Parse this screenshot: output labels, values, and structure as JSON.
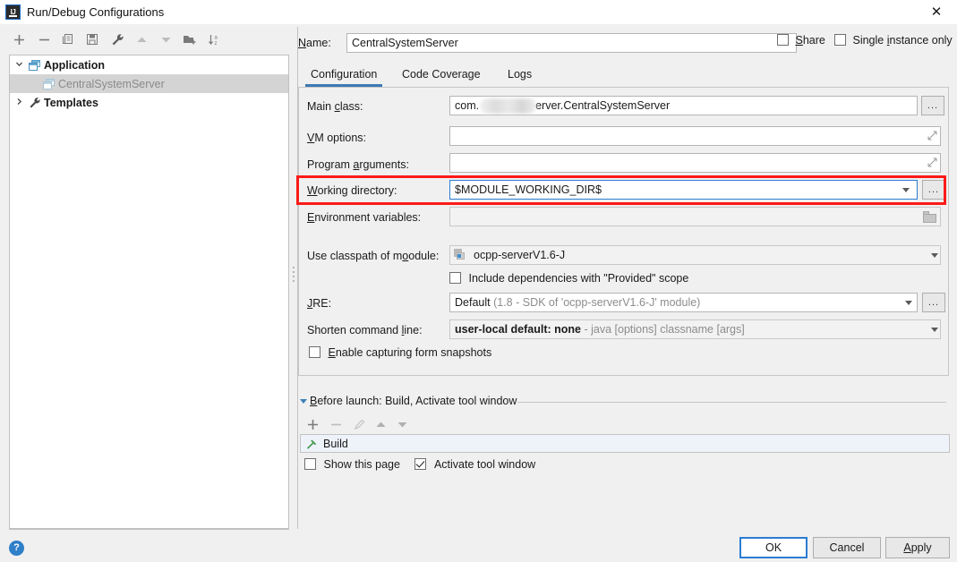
{
  "window": {
    "title": "Run/Debug Configurations",
    "app_icon": "intellij-idea-icon",
    "close_label": "✕"
  },
  "toolbar": {
    "items": [
      {
        "name": "add-configuration",
        "icon": "plus-icon",
        "glyph": "+"
      },
      {
        "name": "remove-configuration",
        "icon": "minus-icon",
        "glyph": "−"
      },
      {
        "name": "copy-configuration",
        "icon": "copy-icon",
        "glyph": "⧉"
      },
      {
        "name": "save-configuration",
        "icon": "save-icon",
        "glyph": "💾"
      },
      {
        "name": "edit-templates",
        "icon": "wrench-icon",
        "glyph": "🔧"
      },
      {
        "name": "move-up",
        "icon": "arrow-up-icon",
        "glyph": "▲"
      },
      {
        "name": "move-down",
        "icon": "arrow-down-icon",
        "glyph": "▼"
      },
      {
        "name": "move-into-folder",
        "icon": "folder-add-icon",
        "glyph": "📁"
      },
      {
        "name": "sort-configurations",
        "icon": "sort-alpha-icon",
        "glyph": "↓"
      }
    ]
  },
  "tree": {
    "nodes": [
      {
        "label": "Application",
        "icon": "application-icon",
        "expanded": true,
        "twisty": "⌄",
        "level": 0,
        "bold": true,
        "selected": false,
        "muted": false
      },
      {
        "label": "CentralSystemServer",
        "icon": "application-icon",
        "expanded": false,
        "twisty": "",
        "level": 1,
        "bold": false,
        "selected": true,
        "muted": true
      },
      {
        "label": "Templates",
        "icon": "wrench-icon",
        "expanded": false,
        "twisty": "›",
        "level": 0,
        "bold": true,
        "selected": false,
        "muted": false
      }
    ]
  },
  "name_row": {
    "label": "Name:",
    "value": "CentralSystemServer",
    "placeholder": "",
    "share_label": "Share",
    "share_checked": false,
    "single_instance_label": "Single instance only",
    "single_instance_checked": false
  },
  "tabs": [
    {
      "label": "Configuration",
      "active": true
    },
    {
      "label": "Code Coverage",
      "active": false
    },
    {
      "label": "Logs",
      "active": false
    }
  ],
  "config": {
    "main_class": {
      "label": "Main class:",
      "value_prefix": "com.",
      "value_suffix": "erver.CentralSystemServer",
      "redacted": true,
      "browse_button": "...",
      "browse_icon": "ellipsis-icon"
    },
    "vm_options": {
      "label": "VM options:",
      "value": "",
      "expand_icon": "expand-diagonal-icon"
    },
    "program_arguments": {
      "label": "Program arguments:",
      "value": "",
      "expand_icon": "expand-diagonal-icon"
    },
    "working_directory": {
      "label": "Working directory:",
      "value": "$MODULE_WORKING_DIR$",
      "dropdown_icon": "chevron-down-icon",
      "browse_button": "...",
      "highlighted": true,
      "highlight_color": "#fb1a17"
    },
    "environment_variables": {
      "label": "Environment variables:",
      "value": "",
      "browse_icon": "folder-icon"
    },
    "use_classpath_of_module": {
      "label": "Use classpath of module:",
      "value": "ocpp-serverV1.6-J",
      "module_icon": "module-icon",
      "dropdown_icon": "chevron-down-icon"
    },
    "include_provided": {
      "label": "Include dependencies with \"Provided\" scope",
      "checked": false
    },
    "jre": {
      "label": "JRE:",
      "value_strong": "Default",
      "value_hint": "(1.8 - SDK of 'ocpp-serverV1.6-J' module)",
      "dropdown_icon": "chevron-down-icon",
      "browse_button": "..."
    },
    "shorten_command_line": {
      "label": "Shorten command line:",
      "value_strong": "user-local default: none",
      "value_hint": "- java [options] classname [args]",
      "dropdown_icon": "chevron-down-icon"
    },
    "enable_snapshots": {
      "label": "Enable capturing form snapshots",
      "checked": false
    }
  },
  "before_launch": {
    "title": "Before launch: Build, Activate tool window",
    "collapse_icon": "triangle-down-icon",
    "tools": [
      {
        "name": "add-task",
        "icon": "plus-icon",
        "glyph": "+"
      },
      {
        "name": "remove-task",
        "icon": "minus-icon",
        "glyph": "−"
      },
      {
        "name": "edit-task",
        "icon": "pencil-icon",
        "glyph": "✎"
      },
      {
        "name": "move-task-up",
        "icon": "arrow-up-icon",
        "glyph": "▲"
      },
      {
        "name": "move-task-down",
        "icon": "arrow-down-icon",
        "glyph": "▼"
      }
    ],
    "tasks": [
      {
        "label": "Build",
        "icon": "build-hammer-icon"
      }
    ],
    "show_this_page": {
      "label": "Show this page",
      "checked": false
    },
    "activate_tool_window": {
      "label": "Activate tool window",
      "checked": true
    }
  },
  "footer": {
    "help_icon": "help-icon",
    "help_glyph": "?",
    "buttons": [
      {
        "label": "OK",
        "primary": true
      },
      {
        "label": "Cancel",
        "primary": false
      },
      {
        "label": "Apply",
        "primary": false
      }
    ]
  }
}
